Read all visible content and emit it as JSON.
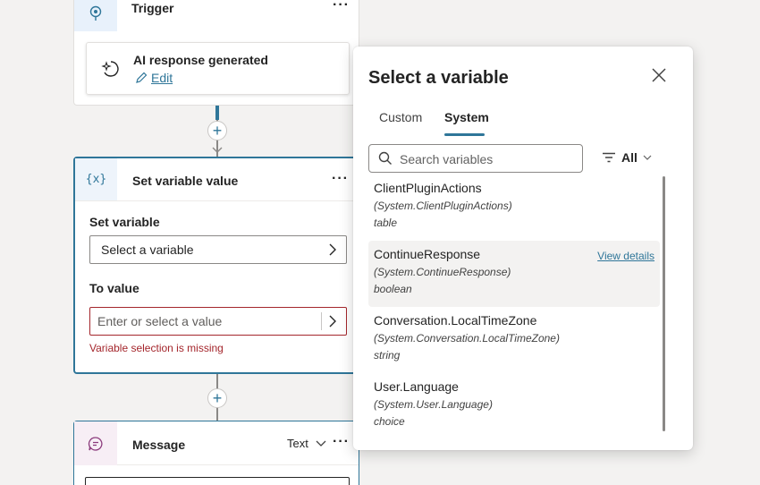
{
  "trigger": {
    "title": "Trigger",
    "more": "···",
    "event": {
      "label": "AI response generated",
      "edit_label": "Edit"
    }
  },
  "set_variable_node": {
    "icon_text": "{x}",
    "title": "Set variable value",
    "more": "···",
    "set_variable_label": "Set variable",
    "set_variable_value": "Select a variable",
    "to_value_label": "To value",
    "to_value_placeholder": "Enter or select a value",
    "error": "Variable selection is missing"
  },
  "message_node": {
    "title": "Message",
    "type_label": "Text",
    "more": "···"
  },
  "connectors": {
    "add_symbol": "+"
  },
  "popup": {
    "title": "Select a variable",
    "tabs": [
      {
        "label": "Custom",
        "active": false
      },
      {
        "label": "System",
        "active": true
      }
    ],
    "search_placeholder": "Search variables",
    "filter_label": "All",
    "variables": [
      {
        "name": "ClientPluginActions",
        "path": "(System.ClientPluginActions)",
        "type": "table"
      },
      {
        "name": "ContinueResponse",
        "path": "(System.ContinueResponse)",
        "type": "boolean",
        "details_link": "View details"
      },
      {
        "name": "Conversation.LocalTimeZone",
        "path": "(System.Conversation.LocalTimeZone)",
        "type": "string"
      },
      {
        "name": "User.Language",
        "path": "(System.User.Language)",
        "type": "choice"
      }
    ]
  },
  "colors": {
    "accent": "#2f7699",
    "error": "#a4262c",
    "message_icon_bg": "#f7eef5",
    "trigger_icon_bg": "#e8f1fb"
  }
}
